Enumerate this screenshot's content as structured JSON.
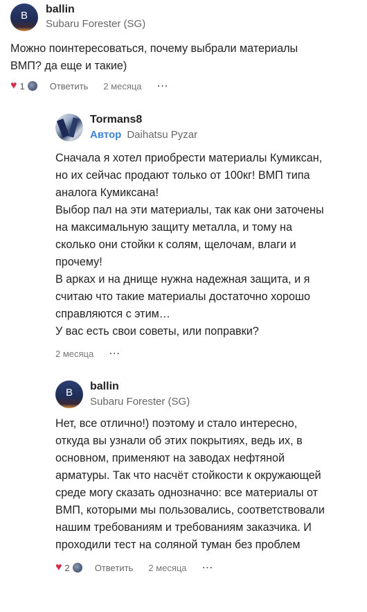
{
  "comments": [
    {
      "author": "ballin",
      "avatar_letter": "B",
      "car": "Subaru Forester (SG)",
      "text": "Можно поинтересоваться, почему выбрали материалы\nВМП? да еще и такие)",
      "likes": "1",
      "reply_label": "Ответить",
      "date": "2 месяца",
      "more": "⋯"
    },
    {
      "author": "Tormans8",
      "badge": "Автор",
      "car": "Daihatsu Pyzar",
      "text": "Сначала я хотел приобрести материалы Кумиксан,\nно их сейчас продают только от 100кг! ВМП типа\nаналога Кумиксана!\nВыбор пал на эти материалы, так как они заточены\nна максимальную защиту металла, и тому на\nсколько они стойки к солям, щелочам, влаги и\nпрочему!\nВ арках и на днище нужна надежная защита, и я\nсчитаю что такие материалы достаточно хорошо\nсправляются с этим…\nУ вас есть свои советы, или поправки?",
      "date": "2 месяца",
      "more": "⋯"
    },
    {
      "author": "ballin",
      "avatar_letter": "B",
      "car": "Subaru Forester (SG)",
      "text": "Нет, все отлично!) поэтому и стало интересно,\nоткуда вы узнали об этих покрытиях, ведь их, в\nосновном, применяют на заводах нефтяной\nарматуры. Так что насчёт стойкости к окружающей\nсреде могу сказать однозначно: все материалы от\nВМП, которыми мы пользовались, соответствовали\nнашим требованиям и требованиям заказчика. И\nпроходили тест на соляной туман без проблем",
      "likes": "2",
      "reply_label": "Ответить",
      "date": "2 месяца",
      "more": "⋯"
    }
  ],
  "colors": {
    "heart": "#d0304a",
    "badge": "#3b82d8"
  },
  "icons": {
    "like": "heart-icon",
    "more": "more-dots-icon"
  }
}
